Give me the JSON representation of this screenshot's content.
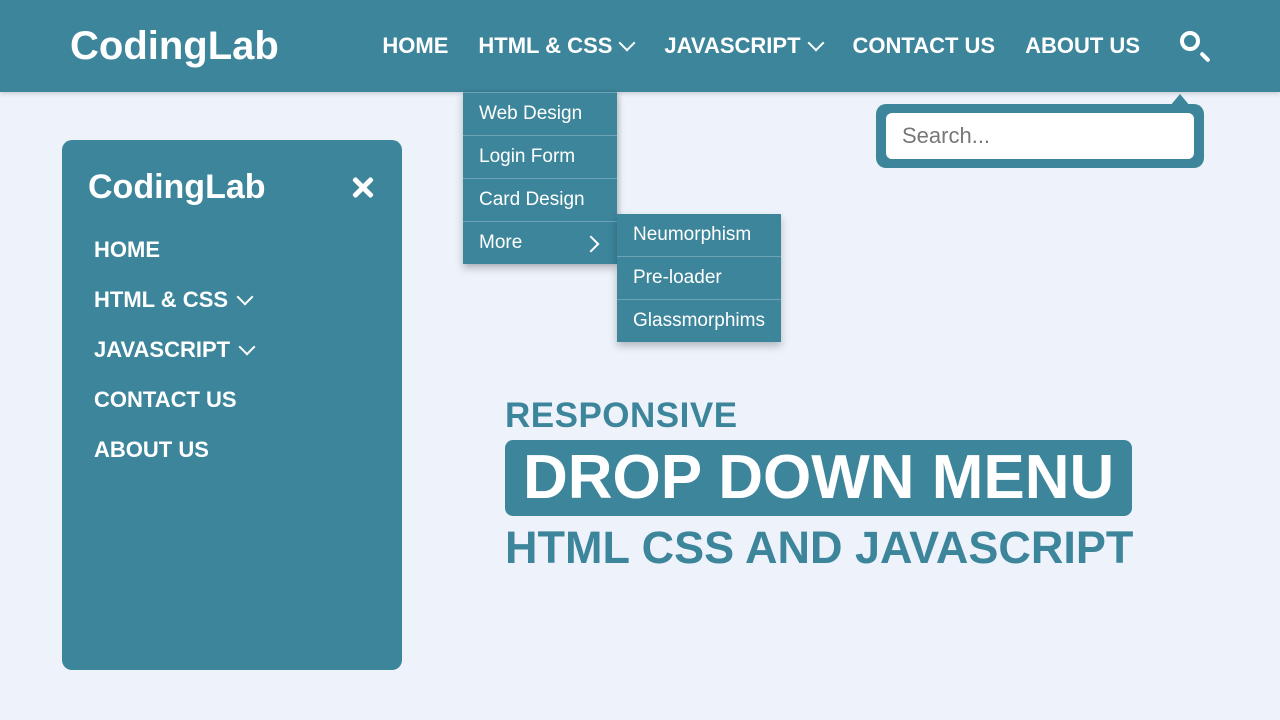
{
  "brand": "CodingLab",
  "nav": {
    "home": "HOME",
    "htmlcss": "HTML & CSS",
    "javascript": "JAVASCRIPT",
    "contact": "CONTACT US",
    "about": "ABOUT US"
  },
  "dropdown": {
    "items": [
      "Web Design",
      "Login Form",
      "Card Design",
      "More"
    ]
  },
  "subDropdown": {
    "items": [
      "Neumorphism",
      "Pre-loader",
      "Glassmorphims"
    ]
  },
  "search": {
    "placeholder": "Search..."
  },
  "sidebar": {
    "items": [
      "HOME",
      "HTML & CSS",
      "JAVASCRIPT",
      "CONTACT US",
      "ABOUT US"
    ]
  },
  "hero": {
    "line1": "RESPONSIVE",
    "line2": "DROP DOWN MENU",
    "line3": "HTML CSS AND JAVASCRIPT"
  }
}
